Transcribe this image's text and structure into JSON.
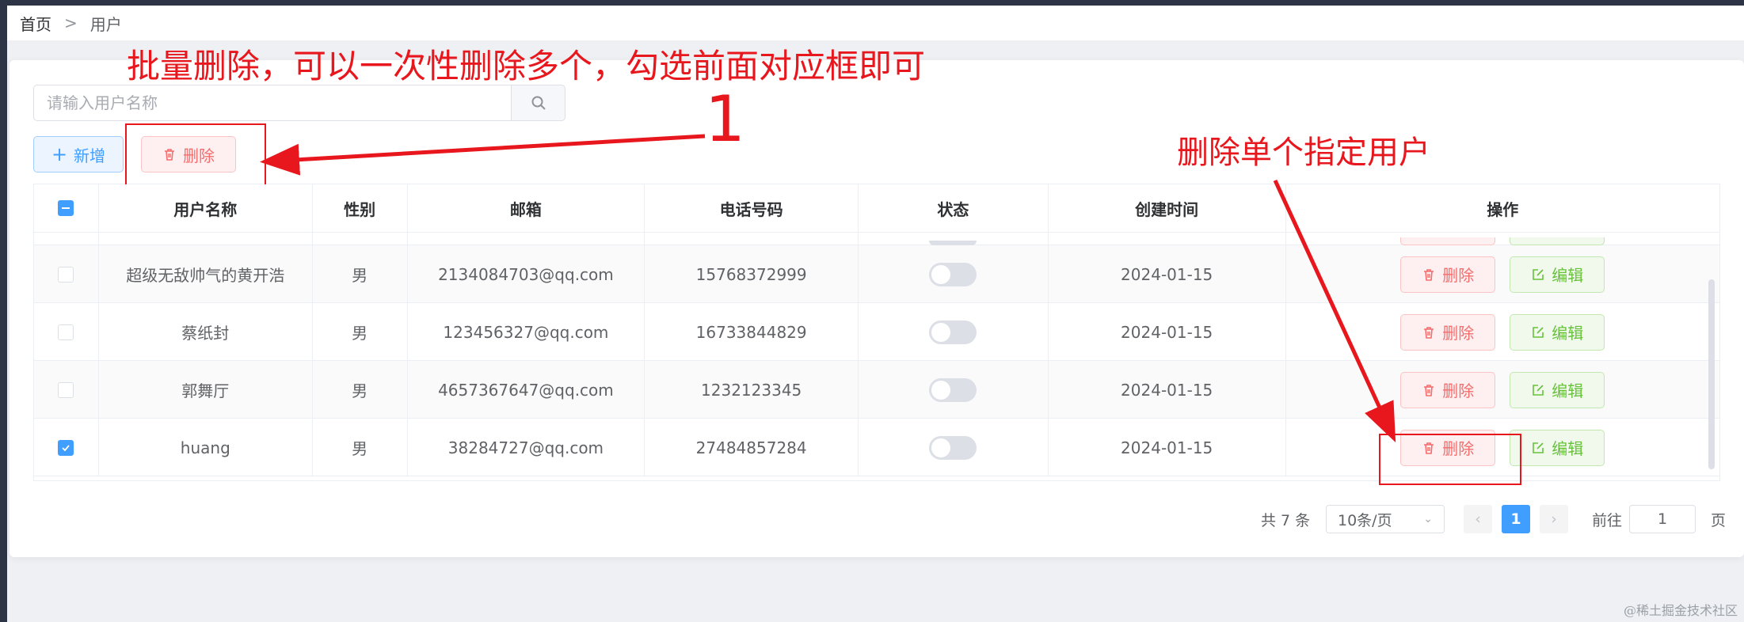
{
  "breadcrumb": {
    "home": "首页",
    "separator": ">",
    "current": "用户"
  },
  "search": {
    "placeholder": "请输入用户名称",
    "value": ""
  },
  "toolbar": {
    "add_label": "新增",
    "delete_label": "删除"
  },
  "table": {
    "columns": [
      "用户名称",
      "性别",
      "邮箱",
      "电话号码",
      "状态",
      "创建时间",
      "操作"
    ],
    "rows": [
      {
        "name": "超级无敌帅气的黄开浩",
        "gender": "男",
        "email": "2134084703@qq.com",
        "phone": "15768372999",
        "status": false,
        "created": "2024-01-15",
        "checked": false
      },
      {
        "name": "蔡纸封",
        "gender": "男",
        "email": "123456327@qq.com",
        "phone": "16733844829",
        "status": false,
        "created": "2024-01-15",
        "checked": false
      },
      {
        "name": "郭舞厅",
        "gender": "男",
        "email": "4657367647@qq.com",
        "phone": "1232123345",
        "status": false,
        "created": "2024-01-15",
        "checked": false
      },
      {
        "name": "huang",
        "gender": "男",
        "email": "38284727@qq.com",
        "phone": "27484857284",
        "status": false,
        "created": "2024-01-15",
        "checked": true
      }
    ],
    "row_delete_label": "删除",
    "row_edit_label": "编辑"
  },
  "pagination": {
    "total": "共 7 条",
    "page_size": "10条/页",
    "current_page": "1",
    "goto_label": "前往",
    "goto_value": "1",
    "page_unit": "页"
  },
  "annotations": {
    "batch_delete": "批量删除，可以一次性删除多个，勾选前面对应框即可",
    "marker": "1",
    "single_delete": "删除单个指定用户"
  },
  "watermark": "@稀土掘金技术社区",
  "colors": {
    "primary": "#409eff",
    "danger": "#f56c6c",
    "success": "#67c23a",
    "annotation": "#e8171d"
  }
}
